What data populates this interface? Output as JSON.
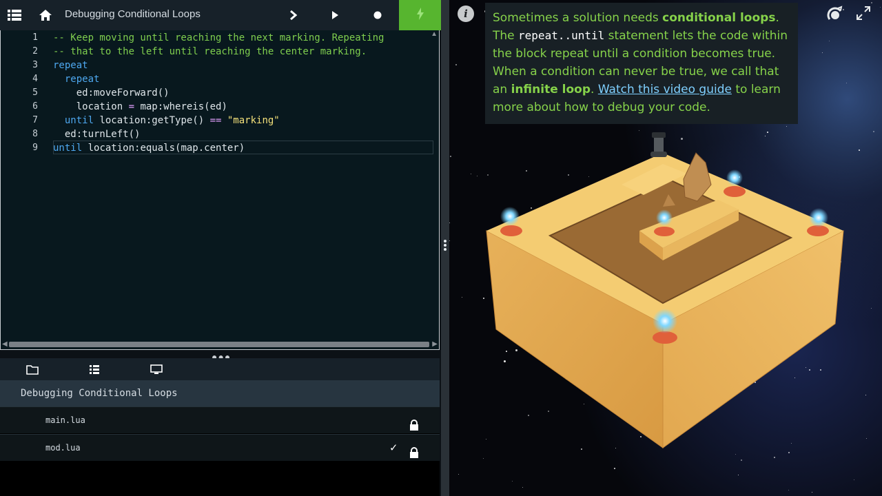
{
  "topbar": {
    "title": "Debugging Conditional Loops",
    "icons": [
      "menu-icon",
      "home-icon",
      "step-icon",
      "play-icon",
      "stop-icon",
      "run-icon"
    ]
  },
  "editor": {
    "line_numbers": [
      "1",
      "2",
      "3",
      "4",
      "5",
      "6",
      "7",
      "8",
      "9"
    ],
    "lines": [
      [
        {
          "c": "cmt",
          "t": "-- Keep moving until reaching the next marking. Repeating"
        }
      ],
      [
        {
          "c": "cmt",
          "t": "-- that to the left until reaching the center marking."
        }
      ],
      [
        {
          "c": "kw",
          "t": "repeat"
        }
      ],
      [
        {
          "c": "kw",
          "t": "  repeat"
        }
      ],
      [
        {
          "c": "tx",
          "t": "    ed:moveForward()"
        }
      ],
      [
        {
          "c": "tx",
          "t": "    location "
        },
        {
          "c": "op",
          "t": "="
        },
        {
          "c": "tx",
          "t": " map:whereis(ed)"
        }
      ],
      [
        {
          "c": "kw",
          "t": "  until"
        },
        {
          "c": "tx",
          "t": " location:getType() "
        },
        {
          "c": "op",
          "t": "=="
        },
        {
          "c": "str",
          "t": " \"marking\""
        }
      ],
      [
        {
          "c": "tx",
          "t": "  ed:turnLeft()"
        }
      ],
      [
        {
          "c": "kw",
          "t": "until"
        },
        {
          "c": "tx",
          "t": " location:equals(map.center)"
        }
      ]
    ]
  },
  "files": {
    "tabs": [
      "folder-icon",
      "list-icon",
      "monitor-icon"
    ],
    "project": "Debugging Conditional Loops",
    "items": [
      {
        "name": "main.lua",
        "locked": true,
        "checked": false
      },
      {
        "name": "mod.lua",
        "locked": true,
        "checked": true
      }
    ]
  },
  "instructions": {
    "p1": "Sometimes a solution needs ",
    "b1": "conditional loops",
    "p2": ". The ",
    "code": "repeat..until",
    "p3": " statement lets the code within the block repeat until a condition becomes true. When a condition can never be true, we call that an ",
    "b2": "infinite loop",
    "p4": ". ",
    "link": "Watch this video guide",
    "p5": " to learn more about how to debug your code."
  },
  "scene": {
    "colors": {
      "sand": "#e9b25a",
      "brick": "#8a5a2c",
      "marker": "#e0603a",
      "glow": "#7fd7ff"
    }
  }
}
